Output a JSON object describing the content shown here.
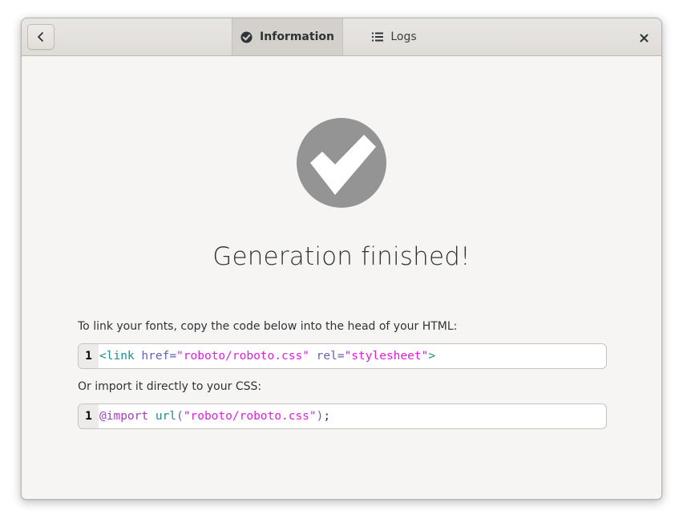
{
  "tabs": [
    {
      "label": "Information",
      "icon": "check-circle-icon",
      "active": true
    },
    {
      "label": "Logs",
      "icon": "list-icon",
      "active": false
    }
  ],
  "status": {
    "icon": "checkmark-icon",
    "headline": "Generation finished!"
  },
  "html_section": {
    "instruction": "To link your fonts, copy the code below into the head of your HTML:",
    "line_number": "1",
    "tokens": [
      "<link",
      " href",
      "=",
      "\"roboto/roboto.css\"",
      " rel",
      "=",
      "\"stylesheet\"",
      ">"
    ]
  },
  "css_section": {
    "instruction": "Or import it directly to your CSS:",
    "line_number": "1",
    "tokens": [
      "@import",
      " url",
      "(",
      "\"roboto/roboto.css\"",
      ")",
      ";"
    ]
  },
  "colors": {
    "window_bg": "#f6f5f4",
    "icon_gray": "#949494",
    "string": "#e01ee0",
    "tag": "#1d8c8c",
    "attribute": "#6161b8",
    "keyword": "#a23dc4"
  }
}
